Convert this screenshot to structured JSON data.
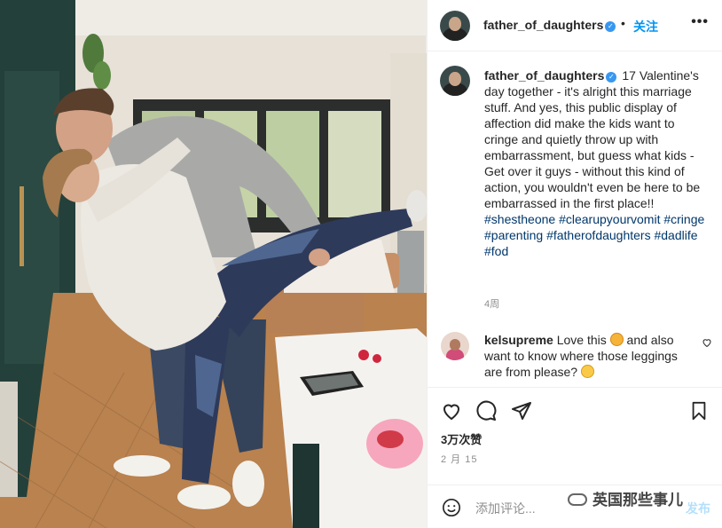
{
  "post": {
    "author": "father_of_daughters",
    "verified_mark": "✓",
    "dot": "•",
    "follow_label": "关注",
    "more_label": "•••"
  },
  "caption": {
    "author": "father_of_daughters",
    "count": "17",
    "text_plain": "Valentine's day together - it's alright this marriage stuff. And yes, this public display of affection did make the kids want to cringe and quietly throw up with embarrassment, but guess what kids - Get over it guys - without this kind of action, you wouldn't even be here to be embarrassed in the first place!!",
    "hashtags": [
      "#shestheone",
      "#clearupyourvomit",
      "#cringe",
      "#parenting",
      "#fatherofdaughters",
      "#dadlife",
      "#fod"
    ],
    "time_ago": "4周"
  },
  "comment": {
    "author": "kelsupreme",
    "text_part1": "Love this",
    "text_part2": "and also want to know where those leggings are from please?"
  },
  "actions": {
    "like_icon": "heart-icon",
    "comment_icon": "comment-icon",
    "share_icon": "share-icon",
    "save_icon": "bookmark-icon",
    "likes": "3万次赞",
    "date": "2 月 15"
  },
  "comment_box": {
    "placeholder": "添加评论...",
    "post_label": "发布"
  },
  "watermark": "英国那些事儿",
  "colors": {
    "link": "#00376b",
    "follow": "#0095f6",
    "verified": "#3897f0",
    "muted": "#8e8e8e"
  }
}
